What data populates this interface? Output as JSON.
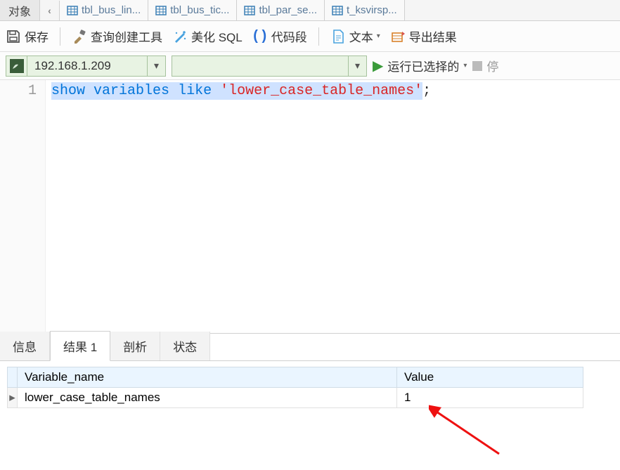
{
  "tabs": {
    "object_tab": "对象",
    "files": [
      "tbl_bus_lin...",
      "tbl_bus_tic...",
      "tbl_par_se...",
      "t_ksvirsp..."
    ]
  },
  "toolbar": {
    "save": "保存",
    "query_builder": "查询创建工具",
    "beautify": "美化 SQL",
    "snippet": "代码段",
    "text": "文本",
    "export": "导出结果"
  },
  "conn": {
    "host": "192.168.1.209",
    "db": "",
    "run": "运行已选择的",
    "stop": "停"
  },
  "editor": {
    "line_no": "1",
    "kw1": "show",
    "kw2": "variables",
    "kw3": "like",
    "str": "'lower_case_table_names'",
    "semi": ";"
  },
  "result_tabs": {
    "info": "信息",
    "result": "结果 1",
    "profile": "剖析",
    "status": "状态"
  },
  "result": {
    "col1": "Variable_name",
    "col2": "Value",
    "r1c1": "lower_case_table_names",
    "r1c2": "1"
  }
}
